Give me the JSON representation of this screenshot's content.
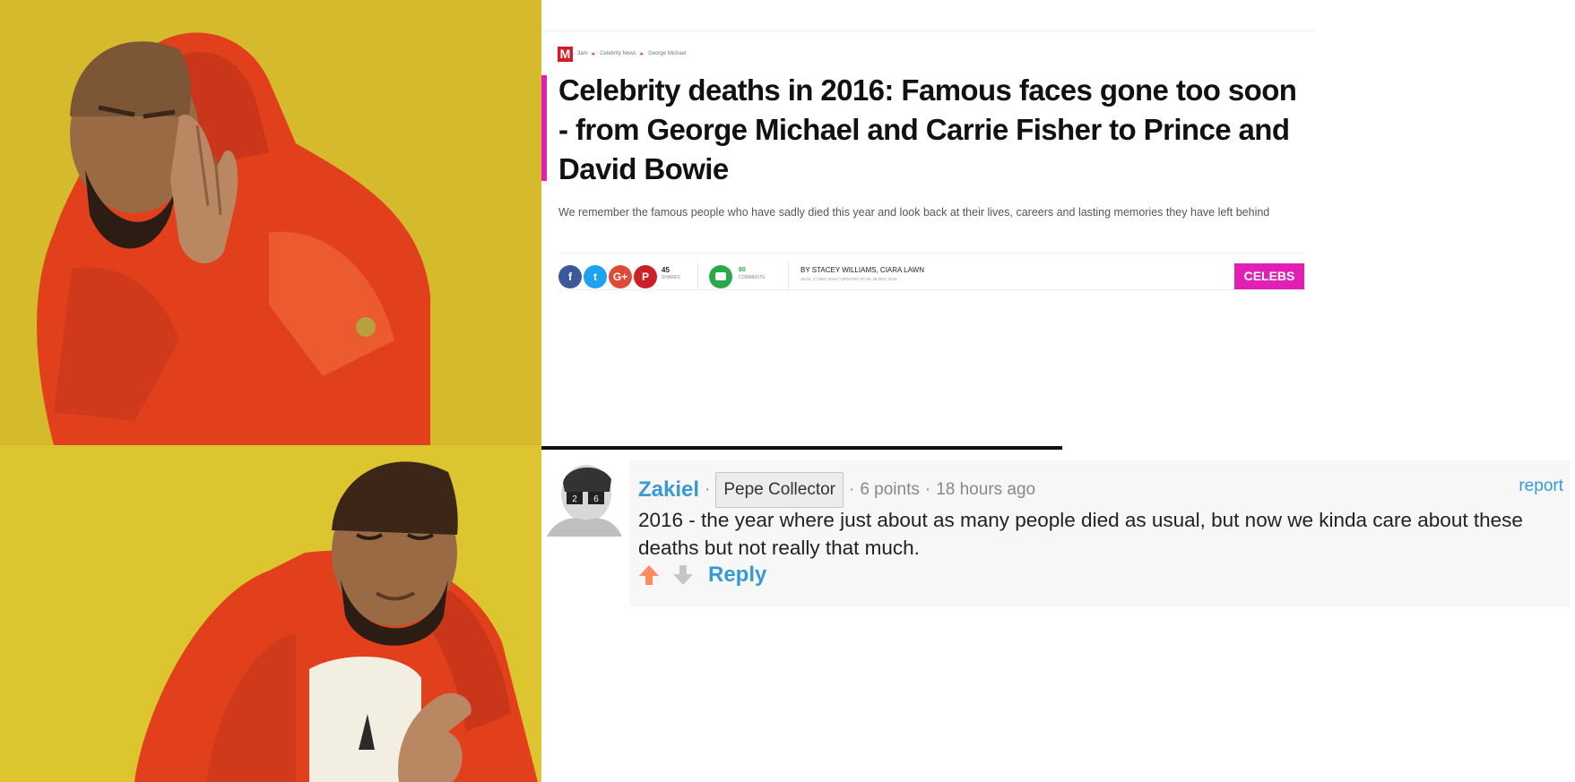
{
  "article": {
    "logo": "M",
    "breadcrumb": [
      "3am",
      "Celebrity News",
      "George Michael"
    ],
    "headline": "Celebrity deaths in 2016: Famous faces gone too soon - from George Michael and Carrie Fisher to Prince and David Bowie",
    "standfirst": "We remember the famous people who have sadly died this year and look back at their lives, careers and lasting memories they have left behind",
    "share_icons": [
      "facebook-icon",
      "twitter-icon",
      "google-plus-icon",
      "pinterest-icon"
    ],
    "share_glyphs": [
      "f",
      "t",
      "G+",
      "P"
    ],
    "shares_count": "45",
    "shares_label": "SHARES",
    "comments_count": "80",
    "comments_label": "COMMENTS",
    "byline": "BY STACEY WILLIAMS, CIARA LAWN",
    "dates": "16:10, 27 DEC 2016 | UPDATED 07:30, 28 DEC 2016",
    "category": "CELEBS",
    "colors": {
      "accent": "#e11fb5",
      "logo": "#d81c25"
    }
  },
  "comment": {
    "username": "Zakiel",
    "flair": "Pepe Collector",
    "points": "6 points",
    "age": "18 hours ago",
    "report": "report",
    "body": "2016 - the year where just about as many people died as usual, but now we kinda care about these deaths but not really that much.",
    "reply": "Reply",
    "colors": {
      "link": "#369ad6",
      "upvote": "#ff8b60",
      "downvote": "#c6c6c6"
    }
  },
  "meme": {
    "top_panel": "rejecting gesture",
    "bottom_panel": "approving gesture",
    "background": "#d9bf2c",
    "jacket": "#e2401c"
  }
}
